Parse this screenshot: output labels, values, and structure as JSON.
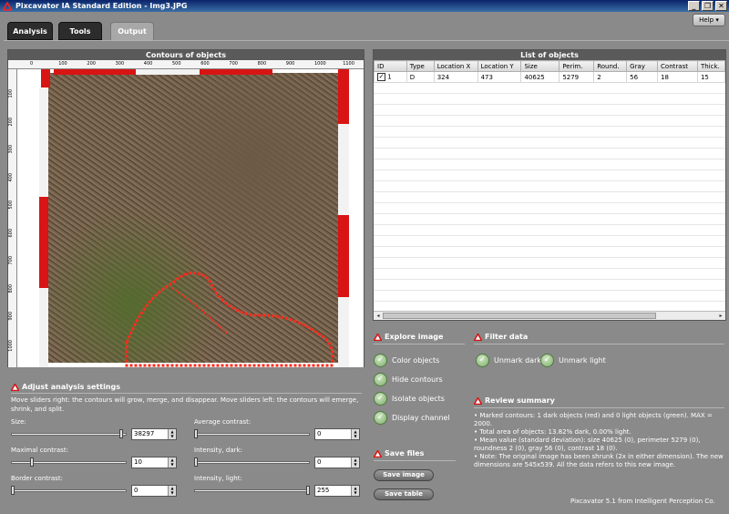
{
  "window": {
    "title": "Pixcavator IA Standard Edition - Img3.JPG",
    "minimize": "_",
    "restore": "❐",
    "close": "✕",
    "help_label": "Help ▾"
  },
  "tabs": [
    {
      "label": "Analysis"
    },
    {
      "label": "Tools"
    },
    {
      "label": "Output"
    }
  ],
  "contours_panel": {
    "title": "Contours of objects",
    "x_ticks": [
      "0",
      "100",
      "200",
      "300",
      "400",
      "500",
      "600",
      "700",
      "800",
      "900",
      "1000",
      "1100"
    ],
    "y_ticks": [
      "100",
      "200",
      "300",
      "400",
      "500",
      "600",
      "700",
      "800",
      "900",
      "1000"
    ]
  },
  "list_panel": {
    "title": "List of objects",
    "columns": [
      "ID",
      "Type",
      "Location X",
      "Location Y",
      "Size",
      "Perim.",
      "Round.",
      "Gray",
      "Contrast",
      "Thick."
    ],
    "rows": [
      {
        "checked": "✓",
        "cells": [
          "1",
          "D",
          "324",
          "473",
          "40625",
          "5279",
          "2",
          "56",
          "18",
          "15"
        ]
      }
    ],
    "scroll_left": "◂",
    "scroll_right": "▸"
  },
  "explore": {
    "title": "Explore image",
    "items": [
      "Color objects",
      "Hide contours",
      "Isolate objects",
      "Display channel"
    ]
  },
  "filter": {
    "title": "Filter data",
    "items": [
      "Unmark dark",
      "Unmark light"
    ]
  },
  "save": {
    "title": "Save files",
    "image_btn": "Save image",
    "table_btn": "Save table"
  },
  "adjust": {
    "title": "Adjust analysis settings",
    "description": "Move sliders right: the contours will grow, merge, and disappear. Move sliders left: the contours will emerge, shrink, and split.",
    "sliders": [
      {
        "label": "Size:",
        "value": "38297",
        "level": 0.97
      },
      {
        "label": "Maximal contrast:",
        "value": "10",
        "level": 0.17
      },
      {
        "label": "Border contrast:",
        "value": "0",
        "level": 0.0
      },
      {
        "label": "Average contrast:",
        "value": "0",
        "level": 0.0
      },
      {
        "label": "Intensity, dark:",
        "value": "0",
        "level": 0.0
      },
      {
        "label": "Intensity, light:",
        "value": "255",
        "level": 1.0
      }
    ]
  },
  "review": {
    "title": "Review summary",
    "lines": [
      "• Marked contours: 1 dark objects (red) and 0 light objects (green). MAX = 2000.",
      "• Total area of objects: 13.82% dark, 0.00% light.",
      "• Mean value (standard deviation): size 40625 (0), perimeter 5279 (0), roundness 2 (0), gray 56 (0), contrast 18 (0).",
      "• Note: The original image has been shrunk (2x in either dimension). The new dimensions are 545x539. All the data refers to this new image."
    ]
  },
  "footer": "Pixcavator 5.1 from Intelligent Perception Co.",
  "colors": {
    "accent_red": "#d81414",
    "title_blue": "#0a246a",
    "check_green": "#7eae6a"
  }
}
